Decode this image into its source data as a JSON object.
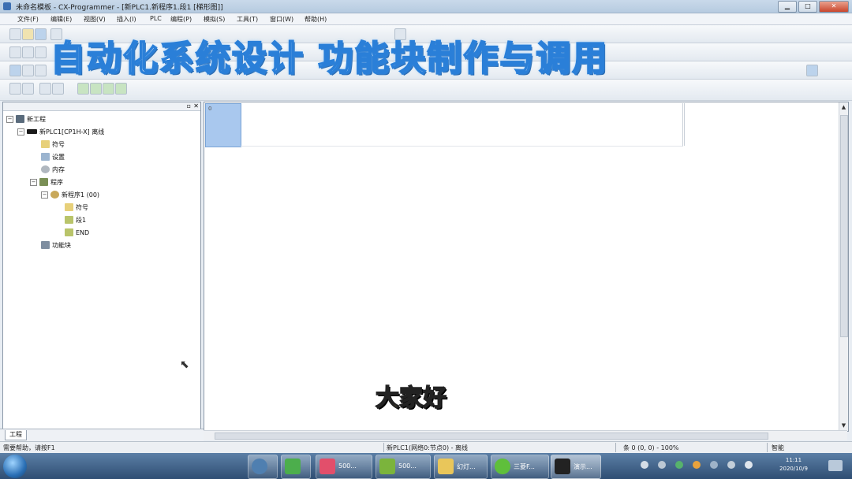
{
  "window": {
    "title": "未命名模板 - CX-Programmer - [新PLC1.新程序1.段1 [梯形图]]"
  },
  "menu": [
    "文件(F)",
    "编辑(E)",
    "视图(V)",
    "插入(I)",
    "PLC",
    "编程(P)",
    "模拟(S)",
    "工具(T)",
    "窗口(W)",
    "帮助(H)"
  ],
  "overlay": {
    "title": "自动化系统设计 功能块制作与调用",
    "subtitle": "大家好"
  },
  "tree": {
    "project": "新工程",
    "plc": "新PLC1[CP1H-X] 离线",
    "symbols": "符号",
    "settings": "设置",
    "memory": "内存",
    "programs": "程序",
    "program1": "新程序1 (00)",
    "program_symbols": "符号",
    "section1": "段1",
    "end": "END",
    "function_blocks": "功能块"
  },
  "tabs": {
    "project_tab": "工程"
  },
  "ladder": {
    "rung_number": "0"
  },
  "status": {
    "help": "需要帮助，请按F1",
    "location": "新PLC1(网络0:节点0) - 离线",
    "rung_info": "条 0 (0, 0) - 100%",
    "mode": "智能"
  },
  "taskbar": {
    "items": [
      "500...",
      "500...",
      "幻灯...",
      "三菱F...",
      "演示..."
    ],
    "clock_time": "11:11",
    "clock_date": "2020/10/9"
  },
  "colors": {
    "overlay_title_outline": "#2a7fd8",
    "subtitle_fill": "#ffe23a",
    "selection": "#a9c8ee"
  }
}
